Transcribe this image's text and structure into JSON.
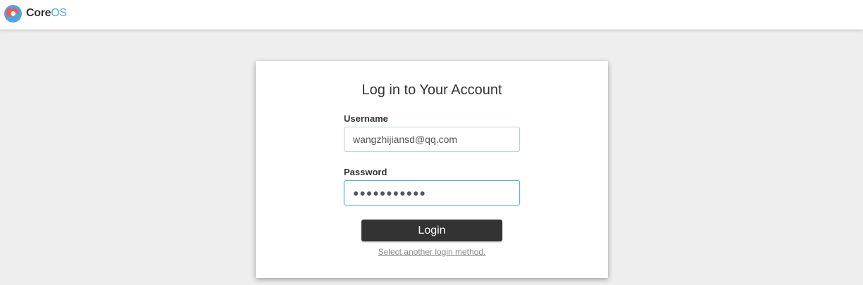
{
  "brand": {
    "name_part1": "Core",
    "name_part2": "OS",
    "logo_icon": "coreos-logo-icon",
    "colors": {
      "blue": "#53a3da",
      "red": "#f2565e",
      "dark": "#333333"
    }
  },
  "login": {
    "title": "Log in to Your Account",
    "username_label": "Username",
    "username_value": "wangzhijiansd@qq.com",
    "password_label": "Password",
    "password_value": "●●●●●●●●●●●",
    "login_button": "Login",
    "alt_method_link": "Select another login method."
  }
}
